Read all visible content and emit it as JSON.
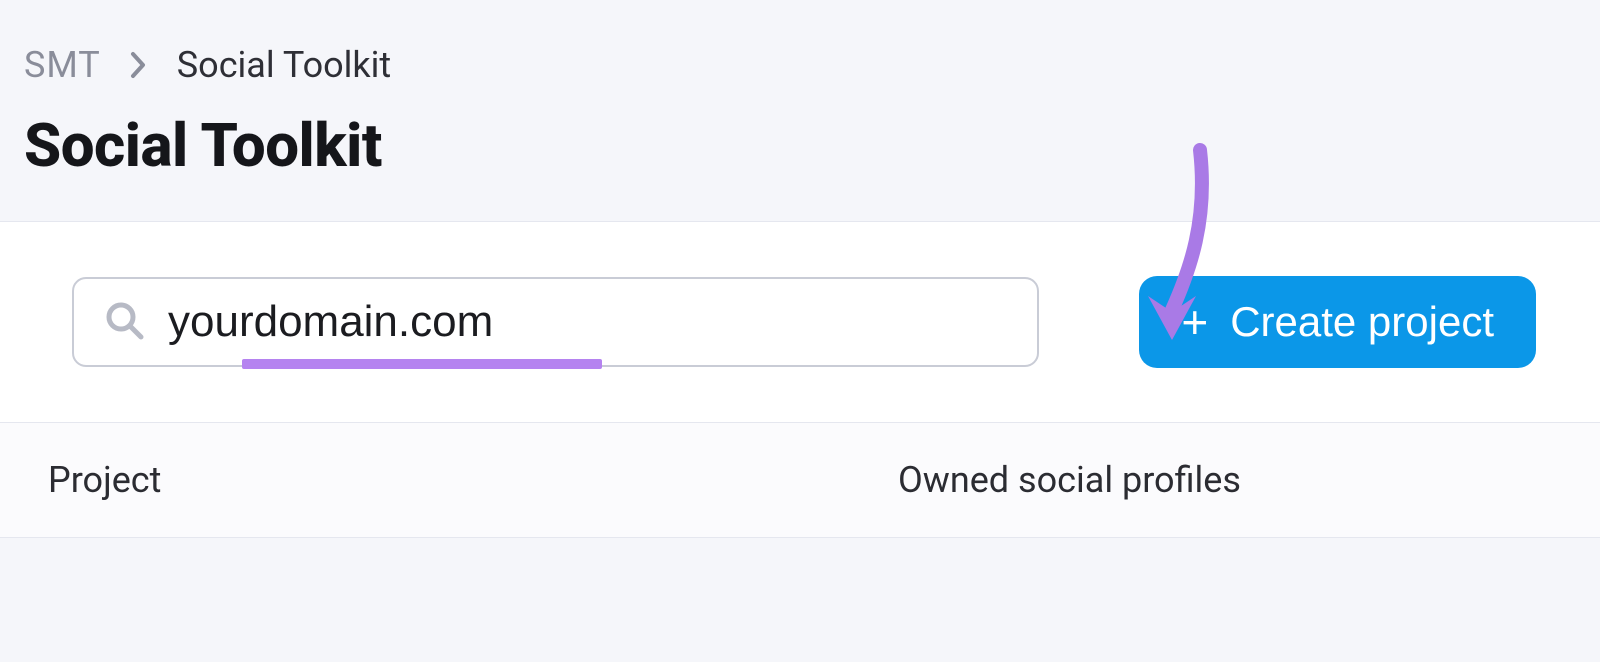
{
  "breadcrumb": {
    "root": "SMT",
    "current": "Social Toolkit"
  },
  "page_title": "Social Toolkit",
  "search": {
    "value": "yourdomain.com",
    "placeholder": ""
  },
  "buttons": {
    "create_project": "Create project"
  },
  "table": {
    "col_project": "Project",
    "col_profiles": "Owned social profiles"
  },
  "colors": {
    "accent_blue": "#0b97e8",
    "annotation_purple": "#b583f0"
  }
}
